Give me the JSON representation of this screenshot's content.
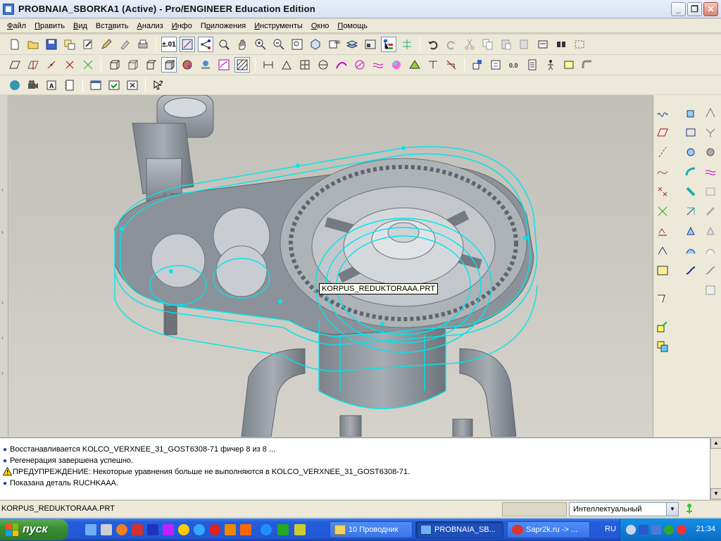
{
  "window": {
    "title": "PROBNAIA_SBORKA1 (Active) - Pro/ENGINEER Education Edition",
    "buttons": {
      "minimize": "_",
      "maximize": "❐",
      "close": "✕"
    }
  },
  "menu": {
    "items": [
      {
        "pre": "",
        "u": "Ф",
        "post": "айл"
      },
      {
        "pre": "",
        "u": "П",
        "post": "равить"
      },
      {
        "pre": "",
        "u": "В",
        "post": "ид"
      },
      {
        "pre": "Вст",
        "u": "а",
        "post": "вить"
      },
      {
        "pre": "",
        "u": "А",
        "post": "нализ"
      },
      {
        "pre": "",
        "u": "И",
        "post": "нфо"
      },
      {
        "pre": "П",
        "u": "р",
        "post": "иложения"
      },
      {
        "pre": "",
        "u": "И",
        "post": "нструменты"
      },
      {
        "pre": "",
        "u": "О",
        "post": "кно"
      },
      {
        "pre": "",
        "u": "П",
        "post": "омощь"
      }
    ]
  },
  "toolbar": {
    "precision_label": "±.01"
  },
  "viewport": {
    "tooltip": "KORPUS_REDUKTORAAA.PRT",
    "colors": {
      "highlight": "#00e5ee",
      "part": "#9aa0a6",
      "background": "#c6c4bd"
    }
  },
  "messages": [
    {
      "type": "info",
      "text": "Восстанавливается KOLCO_VERXNEE_31_GOST6308-71 фичер 8 из 8 ..."
    },
    {
      "type": "info",
      "text": "Регенерация завершена успешно."
    },
    {
      "type": "warning",
      "text": "ПРЕДУПРЕЖДЕНИЕ: Некоторые уравнения больше не выполняются в KOLCO_VERXNEE_31_GOST6308-71."
    },
    {
      "type": "info",
      "text": "Показана деталь RUCHKAAA."
    }
  ],
  "statusbar": {
    "text": "KORPUS_REDUKTORAAA.PRT",
    "filter_value": "Интеллектуальный"
  },
  "taskbar": {
    "start_label": "пуск",
    "tasks": [
      {
        "label": "10 Проводник",
        "state": "inactive"
      },
      {
        "label": "PROBNAIA_SB...",
        "state": "active"
      },
      {
        "label": "Sapr2k.ru -> ...",
        "state": "inactive"
      }
    ],
    "language": "RU",
    "clock": "21:34"
  }
}
